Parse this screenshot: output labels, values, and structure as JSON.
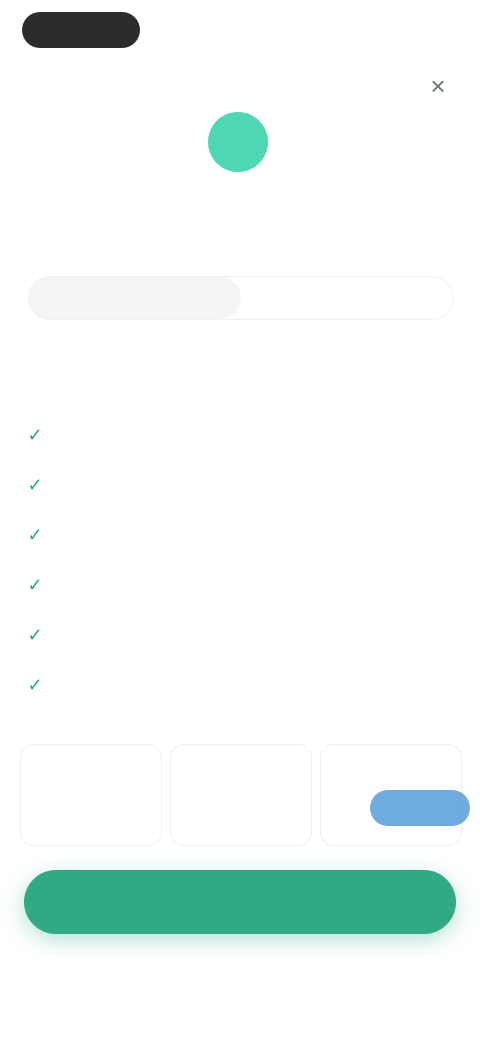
{
  "header": {
    "close_icon": "close-icon",
    "close_glyph": "×"
  },
  "hero": {
    "title": ""
  },
  "plan_tabs": [
    {
      "label": ""
    },
    {
      "label": ""
    }
  ],
  "intro": "",
  "features": [
    {
      "label": ""
    },
    {
      "label": ""
    },
    {
      "label": ""
    },
    {
      "label": ""
    },
    {
      "label": ""
    },
    {
      "label": ""
    }
  ],
  "pricing": {
    "cards": [
      {
        "name": "",
        "price": ""
      },
      {
        "name": "",
        "price": ""
      },
      {
        "name": "",
        "price": ""
      }
    ],
    "badge": ""
  },
  "cta": {
    "label": ""
  },
  "footnote": "",
  "colors": {
    "accent": "#2faa84",
    "logo": "#4fd6b2",
    "badge": "#3d8fd6"
  }
}
